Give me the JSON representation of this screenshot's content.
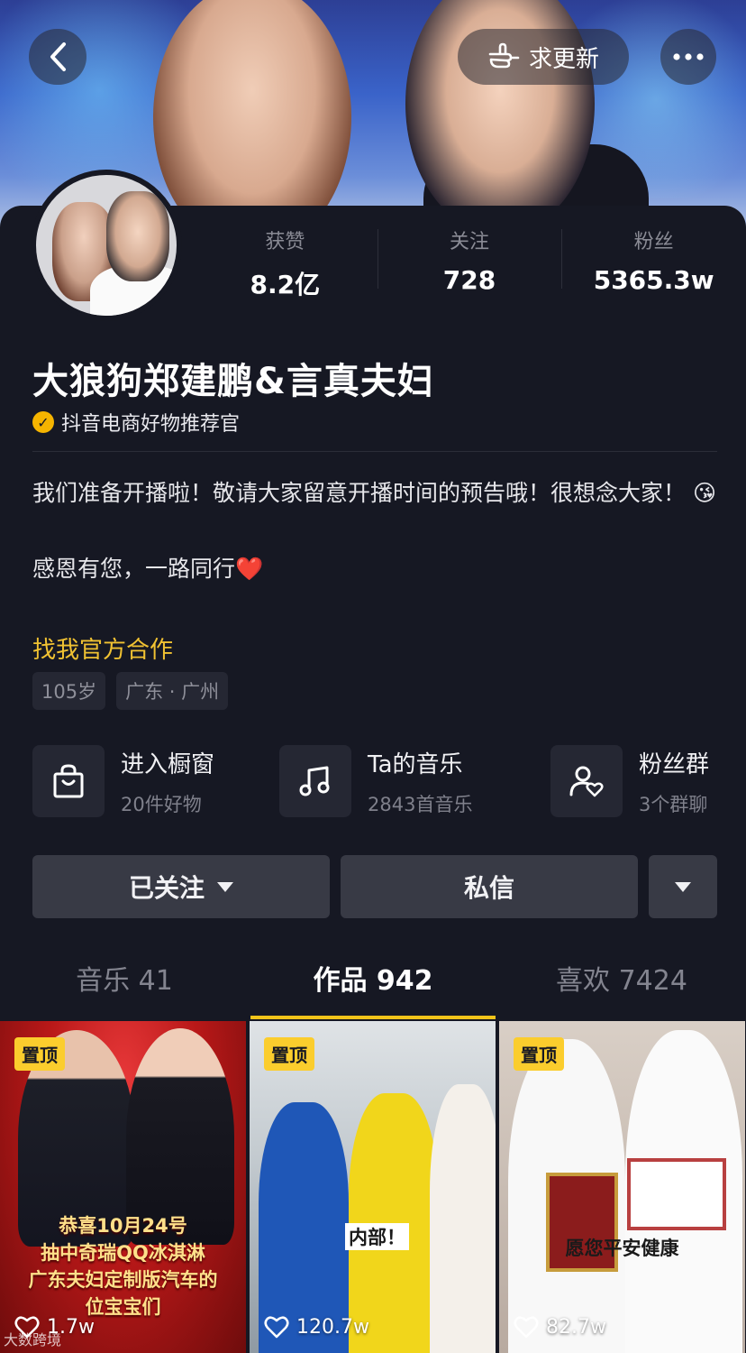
{
  "header": {
    "update_label": "求更新",
    "back_icon": "chevron-left-icon",
    "more_icon": "more-icon"
  },
  "stats": [
    {
      "label": "获赞",
      "value": "8.2亿"
    },
    {
      "label": "关注",
      "value": "728"
    },
    {
      "label": "粉丝",
      "value": "5365.3w"
    }
  ],
  "profile": {
    "name": "大狼狗郑建鹏&言真夫妇",
    "verified_label": "抖音电商好物推荐官",
    "bio_line1": "我们准备开播啦！敬请大家留意开播时间的预告哦！很想念大家！ 😘",
    "bio_line2": "感恩有您，一路同行❤️",
    "cooperation_link": "找我官方合作",
    "tags": [
      "105岁",
      "广东 · 广州"
    ]
  },
  "features": [
    {
      "title": "进入橱窗",
      "subtitle": "20件好物",
      "icon": "shopping-bag-icon"
    },
    {
      "title": "Ta的音乐",
      "subtitle": "2843首音乐",
      "icon": "music-note-icon"
    },
    {
      "title": "粉丝群",
      "subtitle": "3个群聊",
      "icon": "fan-group-icon"
    }
  ],
  "actions": {
    "follow_label": "已关注",
    "message_label": "私信"
  },
  "tabs": [
    {
      "label": "音乐 41",
      "active": false
    },
    {
      "label": "作品 942",
      "active": true
    },
    {
      "label": "喜欢 7424",
      "active": false
    }
  ],
  "videos": [
    {
      "pinned_label": "置顶",
      "likes": "1.7w",
      "caption": "恭喜10月24号\n抽中奇瑞QQ冰淇淋\n广东夫妇定制版汽车的\n位宝宝们"
    },
    {
      "pinned_label": "置顶",
      "likes": "120.7w",
      "caption": "内部！"
    },
    {
      "pinned_label": "置顶",
      "likes": "82.7w",
      "caption": "愿您平安健康"
    }
  ],
  "watermark": "大数跨境",
  "colors": {
    "background": "#161823",
    "accent_yellow": "#f2c41a",
    "link_yellow": "#f1c232",
    "button_gray": "#383a45"
  }
}
